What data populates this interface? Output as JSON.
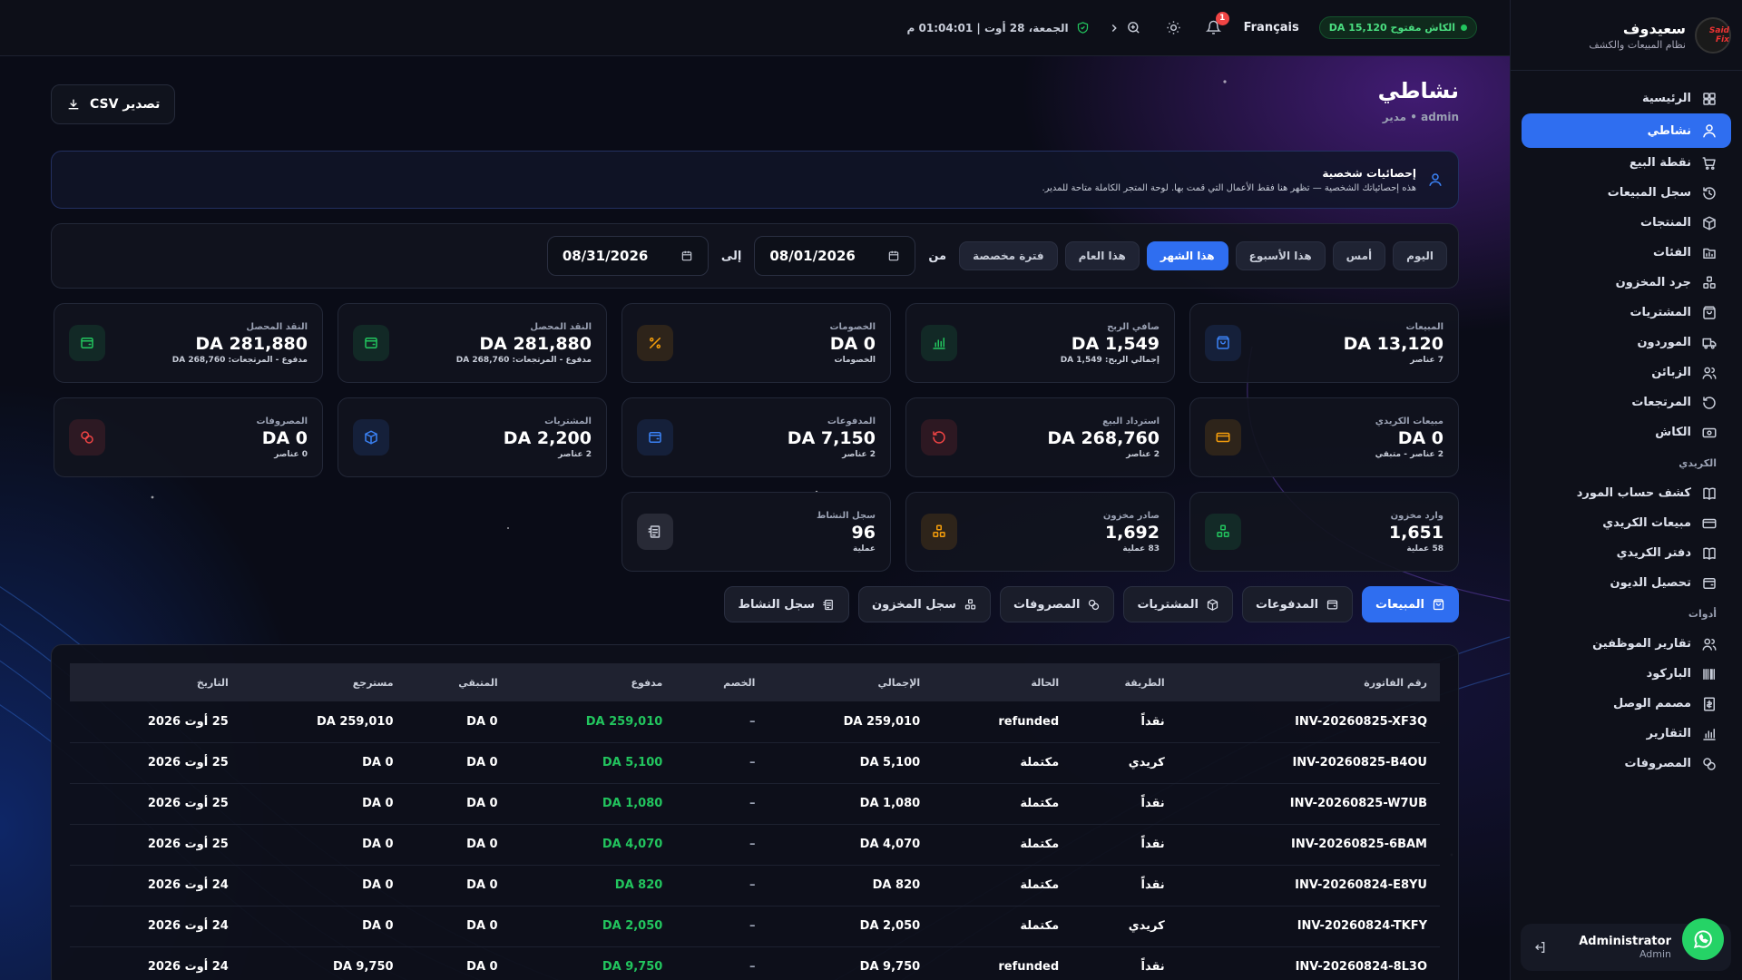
{
  "topbar": {
    "datetime": "الجمعة، 28 أوت | 01:04:01 م",
    "cash_status": "الكاش مفتوح DA 15,120",
    "language": "Français",
    "notifications_count": "1"
  },
  "sidebar": {
    "brand_name": "سعيدوف",
    "brand_sub": "نظام المبيعات والكشف",
    "logo_text": "Said Fix",
    "items": [
      {
        "label": "الرئيسية",
        "icon": "dashboard-icon"
      },
      {
        "label": "نشاطي",
        "icon": "user-icon",
        "active": true
      },
      {
        "label": "نقطة البيع",
        "icon": "cart-icon"
      },
      {
        "label": "سجل المبيعات",
        "icon": "history-icon"
      },
      {
        "label": "المنتجات",
        "icon": "box-icon"
      },
      {
        "label": "الفئات",
        "icon": "folder-icon"
      },
      {
        "label": "جرد المخزون",
        "icon": "inventory-icon"
      },
      {
        "label": "المشتريات",
        "icon": "bag-icon"
      },
      {
        "label": "الموردون",
        "icon": "truck-icon"
      },
      {
        "label": "الزبائن",
        "icon": "users-icon"
      },
      {
        "label": "المرتجعات",
        "icon": "return-icon"
      },
      {
        "label": "الكاش",
        "icon": "cash-icon"
      }
    ],
    "section_credit": "الكريدي",
    "credit_items": [
      {
        "label": "كشف حساب المورد",
        "icon": "book-icon"
      },
      {
        "label": "مبيعات الكريدي",
        "icon": "card-icon"
      },
      {
        "label": "دفتر الكريدي",
        "icon": "book-icon"
      },
      {
        "label": "تحصيل الديون",
        "icon": "wallet-icon"
      }
    ],
    "section_tools": "أدوات",
    "tool_items": [
      {
        "label": "تقارير الموظفين",
        "icon": "users-icon"
      },
      {
        "label": "الباركود",
        "icon": "barcode-icon"
      },
      {
        "label": "مصمم الوصل",
        "icon": "receipt-icon"
      },
      {
        "label": "التقارير",
        "icon": "chart-icon"
      },
      {
        "label": "المصروفات",
        "icon": "coins-icon"
      }
    ],
    "user_name": "Administrator",
    "user_role": "Admin"
  },
  "page": {
    "title": "نشاطي",
    "subtitle": "admin • مدير",
    "export_label": "تصدير CSV",
    "info_title": "إحصائيات شخصية",
    "info_text": "هذه إحصائياتك الشخصية — تظهر هنا فقط الأعمال التي قمت بها. لوحة المتجر الكاملة متاحة للمدير."
  },
  "filter": {
    "periods": [
      "اليوم",
      "أمس",
      "هذا الأسبوع",
      "هذا الشهر",
      "هذا العام",
      "فترة مخصصة"
    ],
    "active_period": "هذا الشهر",
    "from_label": "من",
    "to_label": "إلى",
    "from_date": "08/01/2026",
    "to_date": "08/31/2026"
  },
  "cards": [
    {
      "label": "المبيعات",
      "value": "DA 13,120",
      "sub": "7 عناصر",
      "icon": "bag-icon",
      "color": "#3b82f6"
    },
    {
      "label": "صافي الربح",
      "value": "DA 1,549",
      "sub": "إجمالي الربح: DA 1,549",
      "icon": "chart-icon",
      "color": "#22c55e"
    },
    {
      "label": "الخصومات",
      "value": "DA 0",
      "sub": "الخصومات",
      "icon": "percent-icon",
      "color": "#f59e0b"
    },
    {
      "label": "النقد المحصل",
      "value": "DA 281,880",
      "sub": "مدفوع - المرتجعات: DA 268,760",
      "icon": "wallet-icon",
      "color": "#22c55e"
    },
    {
      "label": "النقد المحصل",
      "value": "DA 281,880",
      "sub": "مدفوع - المرتجعات: DA 268,760",
      "icon": "wallet-icon",
      "color": "#22c55e"
    },
    {
      "label": "مبيعات الكريدي",
      "value": "DA 0",
      "sub": "2 عناصر - متبقي",
      "icon": "card-icon",
      "color": "#f59e0b"
    },
    {
      "label": "استرداد البيع",
      "value": "DA 268,760",
      "sub": "2 عناصر",
      "icon": "return-icon",
      "color": "#ef4444"
    },
    {
      "label": "المدفوعات",
      "value": "DA 7,150",
      "sub": "2 عناصر",
      "icon": "wallet-icon",
      "color": "#3b82f6"
    },
    {
      "label": "المشتريات",
      "value": "DA 2,200",
      "sub": "2 عناصر",
      "icon": "box-icon",
      "color": "#3b82f6"
    },
    {
      "label": "المصروفات",
      "value": "DA 0",
      "sub": "0 عناصر",
      "icon": "coins-icon",
      "color": "#ef4444"
    },
    {
      "label": "وارد مخزون",
      "value": "1,651",
      "sub": "58 عملية",
      "icon": "inventory-icon",
      "color": "#22c55e"
    },
    {
      "label": "صادر مخزون",
      "value": "1,692",
      "sub": "83 عملية",
      "icon": "inventory-icon",
      "color": "#f59e0b"
    },
    {
      "label": "سجل النشاط",
      "value": "96",
      "sub": "عملية",
      "icon": "log-icon",
      "color": "#c7ccd8"
    }
  ],
  "tabs": [
    {
      "label": "المبيعات",
      "icon": "bag-icon",
      "active": true
    },
    {
      "label": "المدفوعات",
      "icon": "wallet-icon"
    },
    {
      "label": "المشتريات",
      "icon": "box-icon"
    },
    {
      "label": "المصروفات",
      "icon": "coins-icon"
    },
    {
      "label": "سجل المخزون",
      "icon": "inventory-icon"
    },
    {
      "label": "سجل النشاط",
      "icon": "log-icon"
    }
  ],
  "table": {
    "headers": [
      "رقم الفاتورة",
      "الطريقة",
      "الحالة",
      "الإجمالي",
      "الخصم",
      "مدفوع",
      "المتبقي",
      "مسترجع",
      "التاريخ"
    ],
    "rows": [
      [
        "INV-20260825-XF3Q",
        "نقداً",
        "refunded",
        "DA 259,010",
        "–",
        "DA 259,010",
        "DA 0",
        "DA 259,010",
        "25 أوت 2026"
      ],
      [
        "INV-20260825-B4OU",
        "كريدي",
        "مكتملة",
        "DA 5,100",
        "–",
        "DA 5,100",
        "DA 0",
        "DA 0",
        "25 أوت 2026"
      ],
      [
        "INV-20260825-W7UB",
        "نقداً",
        "مكتملة",
        "DA 1,080",
        "–",
        "DA 1,080",
        "DA 0",
        "DA 0",
        "25 أوت 2026"
      ],
      [
        "INV-20260825-6BAM",
        "نقداً",
        "مكتملة",
        "DA 4,070",
        "–",
        "DA 4,070",
        "DA 0",
        "DA 0",
        "25 أوت 2026"
      ],
      [
        "INV-20260824-E8YU",
        "نقداً",
        "مكتملة",
        "DA 820",
        "–",
        "DA 820",
        "DA 0",
        "DA 0",
        "24 أوت 2026"
      ],
      [
        "INV-20260824-TKFY",
        "كريدي",
        "مكتملة",
        "DA 2,050",
        "–",
        "DA 2,050",
        "DA 0",
        "DA 0",
        "24 أوت 2026"
      ],
      [
        "INV-20260824-8L3O",
        "نقداً",
        "refunded",
        "DA 9,750",
        "–",
        "DA 9,750",
        "DA 0",
        "DA 9,750",
        "24 أوت 2026"
      ]
    ]
  }
}
